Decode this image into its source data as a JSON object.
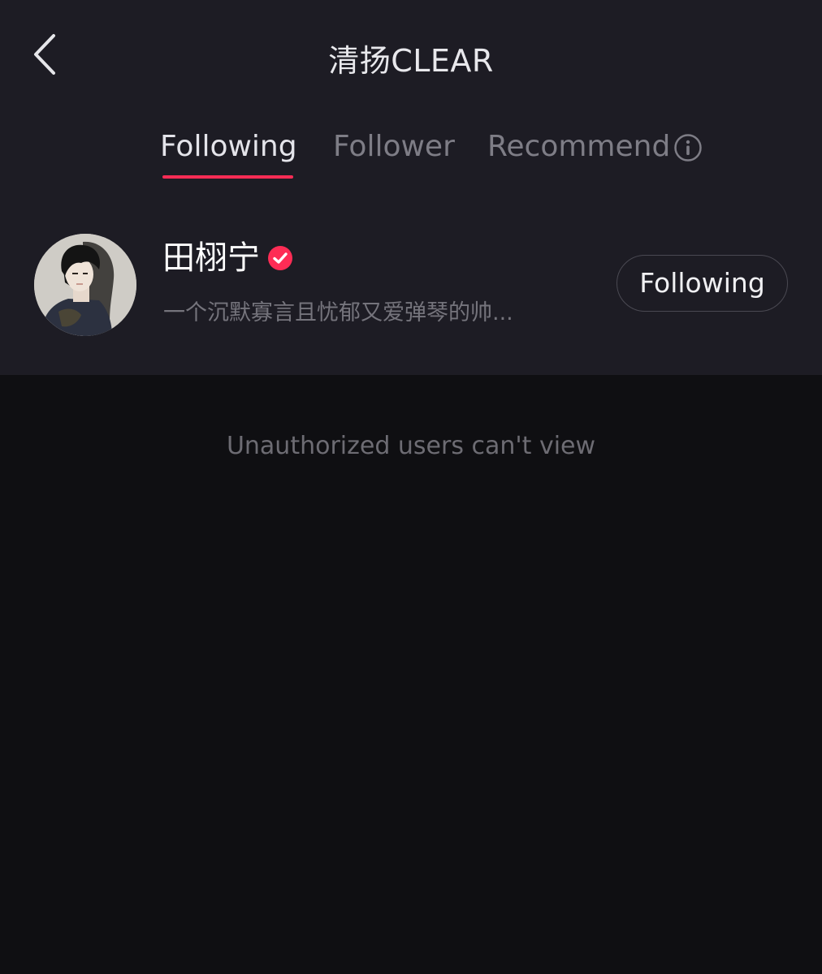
{
  "header": {
    "title": "清扬CLEAR",
    "back_icon": "chevron-left-icon"
  },
  "tabs": [
    {
      "label": "Following",
      "active": true
    },
    {
      "label": "Follower",
      "active": false
    },
    {
      "label": "Recommend",
      "active": false,
      "icon": "info-icon"
    }
  ],
  "accent_color": "#fe2c55",
  "user": {
    "name": "田栩宁",
    "verified": true,
    "bio": "一个沉默寡言且忧郁又爱弹琴的帅...",
    "follow_button_label": "Following"
  },
  "notice": "Unauthorized users can't view"
}
